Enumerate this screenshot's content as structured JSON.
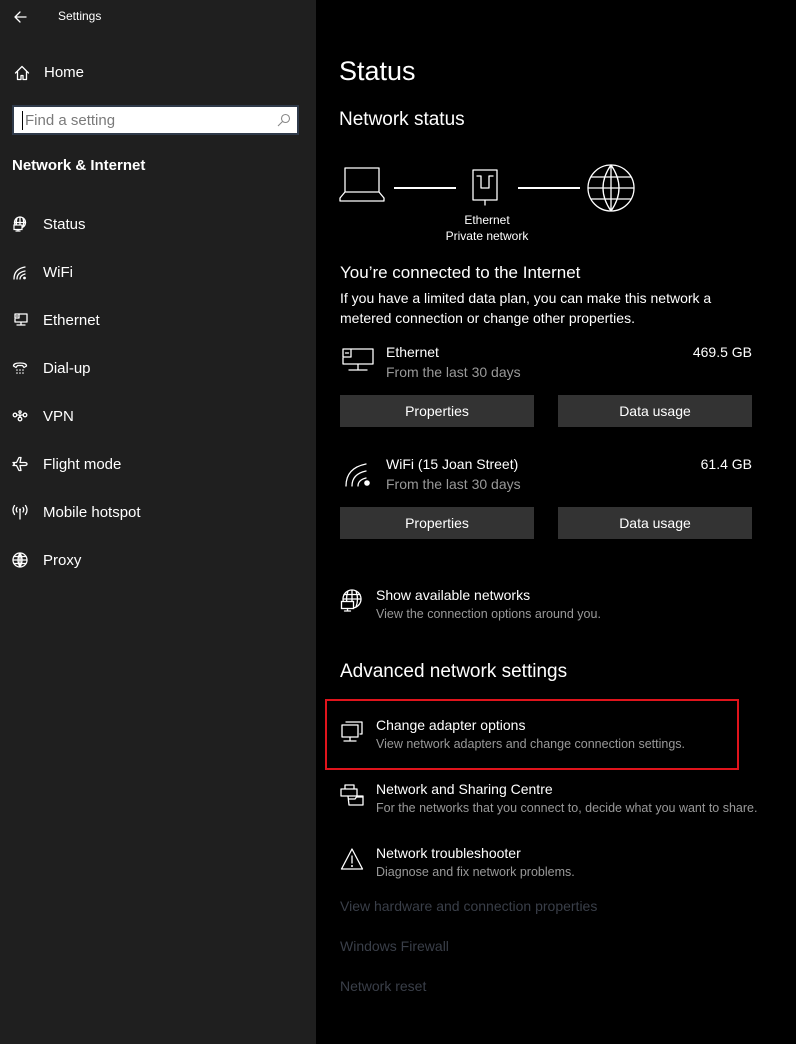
{
  "window": {
    "title": "Settings",
    "back_icon": "arrow-left-icon"
  },
  "sidebar": {
    "home_label": "Home",
    "search_placeholder": "Find a setting",
    "search_value": "",
    "section_title": "Network & Internet",
    "items": [
      {
        "label": "Status",
        "icon": "network-status-icon"
      },
      {
        "label": "WiFi",
        "icon": "wifi-icon"
      },
      {
        "label": "Ethernet",
        "icon": "ethernet-icon"
      },
      {
        "label": "Dial-up",
        "icon": "dialup-icon"
      },
      {
        "label": "VPN",
        "icon": "vpn-icon"
      },
      {
        "label": "Flight mode",
        "icon": "airplane-icon"
      },
      {
        "label": "Mobile hotspot",
        "icon": "hotspot-icon"
      },
      {
        "label": "Proxy",
        "icon": "globe-icon"
      }
    ]
  },
  "main": {
    "page_title": "Status",
    "network_status_heading": "Network status",
    "diagram": {
      "adapter_name": "Ethernet",
      "network_type": "Private network"
    },
    "connected_heading": "You’re connected to the Internet",
    "connected_desc": "If you have a limited data plan, you can make this network a metered connection or change other properties.",
    "connections": [
      {
        "name": "Ethernet",
        "period": "From the last 30 days",
        "usage": "469.5 GB",
        "properties_label": "Properties",
        "data_usage_label": "Data usage"
      },
      {
        "name": "WiFi (15 Joan Street)",
        "period": "From the last 30 days",
        "usage": "61.4 GB",
        "properties_label": "Properties",
        "data_usage_label": "Data usage"
      }
    ],
    "show_networks": {
      "title": "Show available networks",
      "subtitle": "View the connection options around you."
    },
    "advanced_heading": "Advanced network settings",
    "advanced_items": [
      {
        "title": "Change adapter options",
        "subtitle": "View network adapters and change connection settings."
      },
      {
        "title": "Network and Sharing Centre",
        "subtitle": "For the networks that you connect to, decide what you want to share."
      },
      {
        "title": "Network troubleshooter",
        "subtitle": "Diagnose and fix network problems."
      }
    ],
    "links": [
      "View hardware and connection properties",
      "Windows Firewall",
      "Network reset"
    ],
    "highlight_color": "#e0141c"
  }
}
